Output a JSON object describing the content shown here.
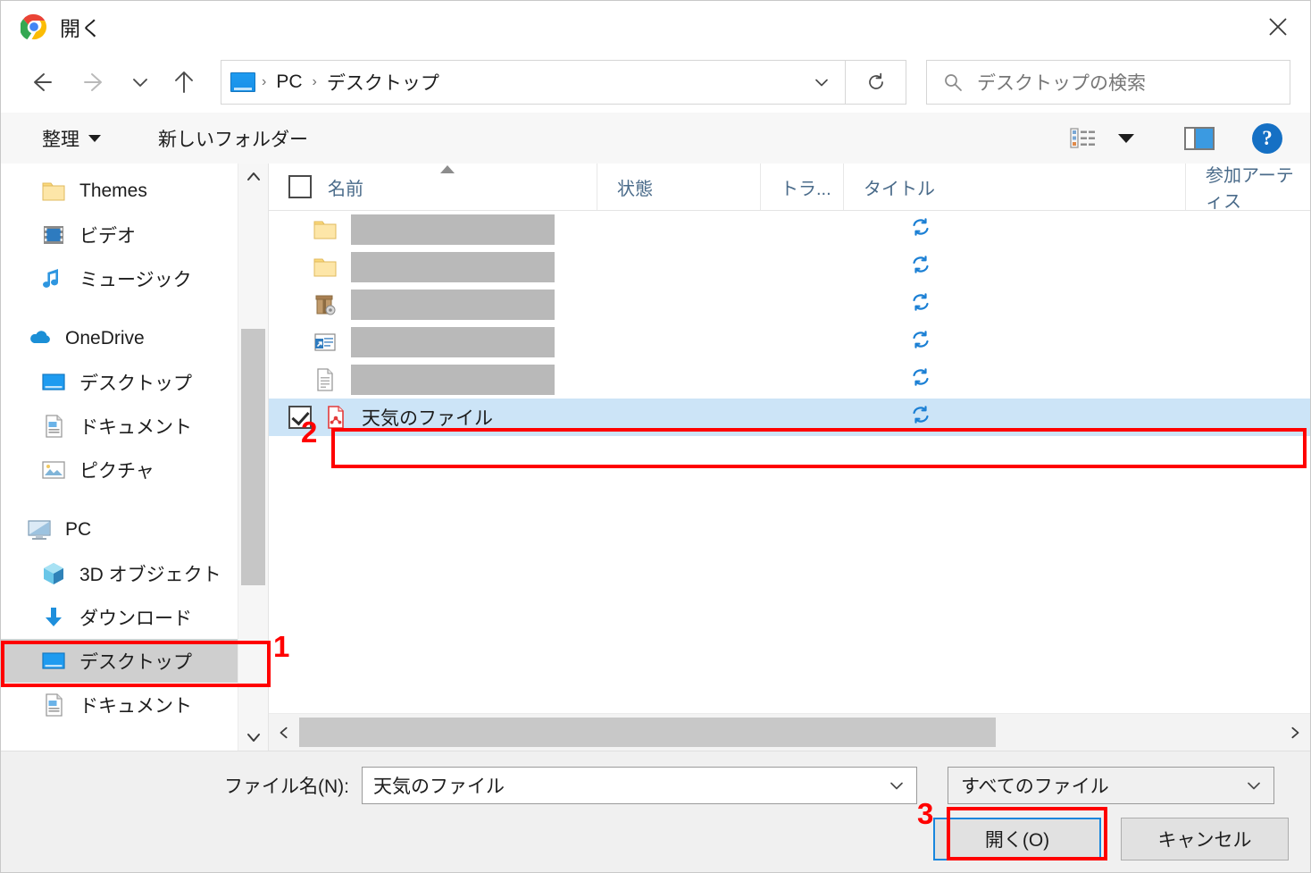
{
  "window": {
    "title": "開く",
    "app_icon": "chrome-icon",
    "close_label": "×"
  },
  "nav": {
    "back_icon": "back-arrow-icon",
    "forward_icon": "forward-arrow-icon",
    "history_icon": "chevron-down-icon",
    "up_icon": "up-arrow-icon",
    "breadcrumb": {
      "root_icon": "desktop-icon",
      "items": [
        "PC",
        "デスクトップ"
      ],
      "separator": "›"
    },
    "address_dropdown_icon": "chevron-down-icon",
    "refresh_icon": "refresh-icon",
    "search": {
      "icon": "search-icon",
      "placeholder": "デスクトップの検索",
      "value": ""
    }
  },
  "commandbar": {
    "organize": "整理",
    "organize_caret": "caret-down-icon",
    "new_folder": "新しいフォルダー",
    "view_icon": "list-view-icon",
    "view_caret": "caret-down-icon",
    "preview_pane_icon": "preview-pane-icon",
    "help_icon": "help-icon",
    "help_glyph": "?"
  },
  "sidebar": {
    "groups": [
      {
        "items": [
          {
            "label": "Themes",
            "icon": "folder-icon",
            "indent": true,
            "selected": false
          },
          {
            "label": "ビデオ",
            "icon": "videos-icon",
            "indent": true,
            "selected": false
          },
          {
            "label": "ミュージック",
            "icon": "music-icon",
            "indent": true,
            "selected": false
          }
        ]
      },
      {
        "items": [
          {
            "label": "OneDrive",
            "icon": "onedrive-cloud-icon",
            "indent": false,
            "selected": false
          },
          {
            "label": "デスクトップ",
            "icon": "desktop-icon",
            "indent": true,
            "selected": false
          },
          {
            "label": "ドキュメント",
            "icon": "documents-icon",
            "indent": true,
            "selected": false
          },
          {
            "label": "ピクチャ",
            "icon": "pictures-icon",
            "indent": true,
            "selected": false
          }
        ]
      },
      {
        "items": [
          {
            "label": "PC",
            "icon": "this-pc-icon",
            "indent": false,
            "selected": false
          },
          {
            "label": "3D オブジェクト",
            "icon": "3d-objects-icon",
            "indent": true,
            "selected": false
          },
          {
            "label": "ダウンロード",
            "icon": "downloads-icon",
            "indent": true,
            "selected": false
          },
          {
            "label": "デスクトップ",
            "icon": "desktop-icon",
            "indent": true,
            "selected": true
          },
          {
            "label": "ドキュメント",
            "icon": "documents-icon",
            "indent": true,
            "selected": false
          }
        ]
      }
    ],
    "scrollbar": {
      "up_icon": "chevron-up-icon",
      "down_icon": "chevron-down-icon"
    }
  },
  "filelist": {
    "columns": [
      {
        "key": "name",
        "label": "名前",
        "sorted": true
      },
      {
        "key": "state",
        "label": "状態",
        "sorted": false
      },
      {
        "key": "track",
        "label": "トラ...",
        "sorted": false
      },
      {
        "key": "title",
        "label": "タイトル",
        "sorted": false
      },
      {
        "key": "artist",
        "label": "参加アーティス",
        "sorted": false
      }
    ],
    "header_checkbox": false,
    "sort_indicator": "sort-ascending-icon",
    "rows": [
      {
        "name": "",
        "redacted": true,
        "icon": "folder-icon",
        "checked": false,
        "state_icon": "sync-pending-icon",
        "selected": false
      },
      {
        "name": "",
        "redacted": true,
        "icon": "folder-icon",
        "checked": false,
        "state_icon": "sync-pending-icon",
        "selected": false
      },
      {
        "name": "",
        "redacted": true,
        "icon": "archive-icon",
        "checked": false,
        "state_icon": "sync-pending-icon",
        "selected": false
      },
      {
        "name": "",
        "redacted": true,
        "icon": "shortcut-icon",
        "checked": false,
        "state_icon": "sync-pending-icon",
        "selected": false
      },
      {
        "name": "",
        "redacted": true,
        "icon": "text-file-icon",
        "checked": false,
        "state_icon": "sync-pending-icon",
        "selected": false
      },
      {
        "name": "天気のファイル",
        "redacted": false,
        "icon": "pdf-file-icon",
        "checked": true,
        "state_icon": "sync-pending-icon",
        "selected": true
      }
    ],
    "hscroll": {
      "left_icon": "chevron-left-icon",
      "right_icon": "chevron-right-icon"
    }
  },
  "footer": {
    "filename_label": "ファイル名(N):",
    "filename_value": "天気のファイル",
    "filename_dropdown_icon": "chevron-down-icon",
    "filetype_value": "すべてのファイル",
    "filetype_dropdown_icon": "chevron-down-icon",
    "open_button": "開く(O)",
    "cancel_button": "キャンセル"
  },
  "annotations": [
    {
      "id": "1",
      "number": "1",
      "target": "sidebar-desktop-item"
    },
    {
      "id": "2",
      "number": "2",
      "target": "selected-file-row"
    },
    {
      "id": "3",
      "number": "3",
      "target": "open-button"
    }
  ],
  "colors": {
    "accent_blue": "#1886dd",
    "selection_blue": "#cce4f7",
    "annotation_red": "#ff0000",
    "sidebar_selected": "#cfcfcf",
    "header_text": "#4a6b8a"
  }
}
